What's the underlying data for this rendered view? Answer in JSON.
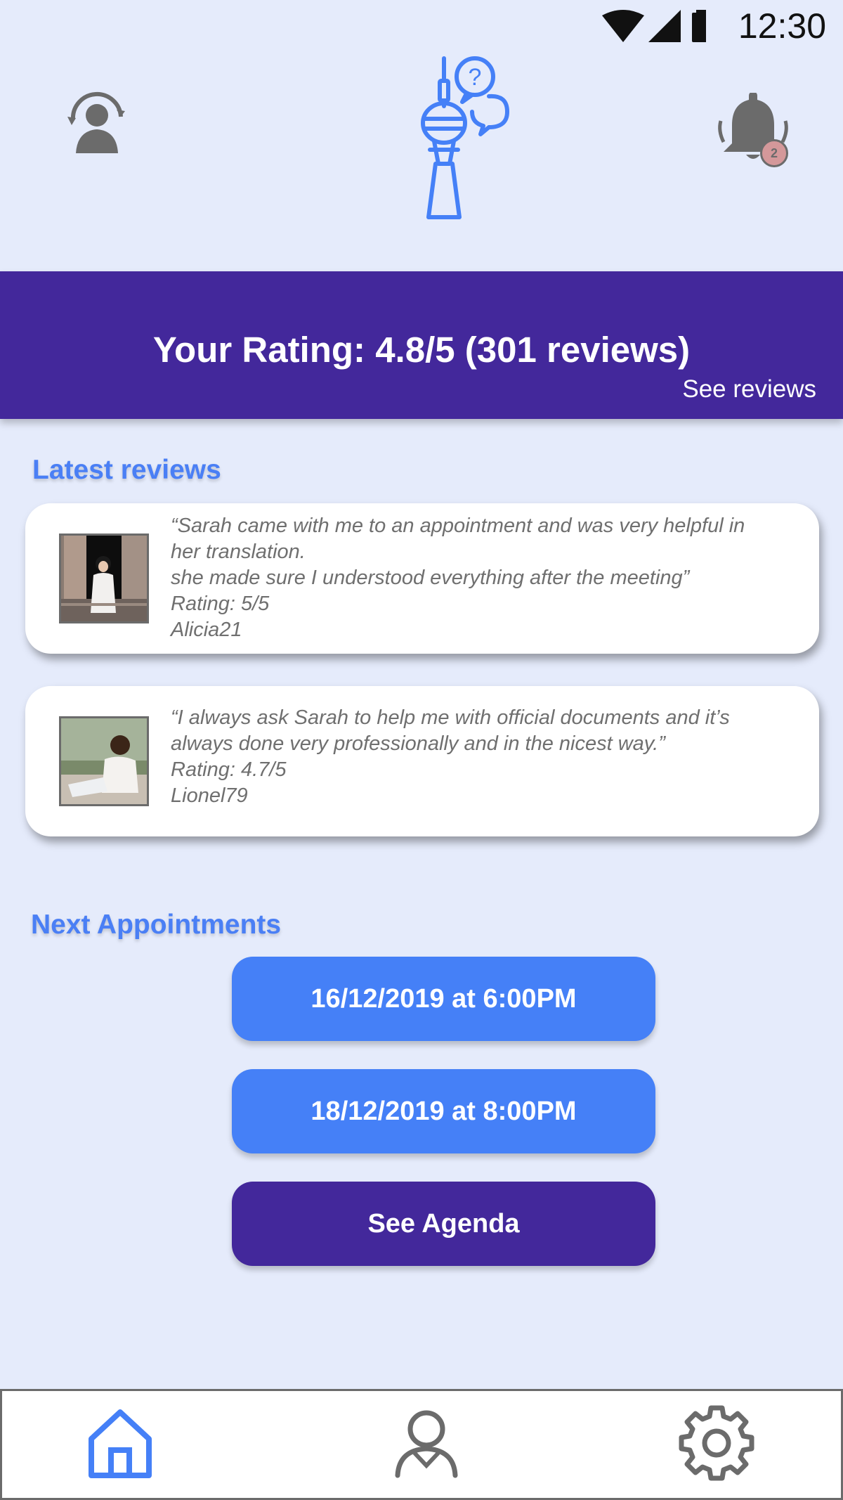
{
  "status_bar": {
    "time": "12:30"
  },
  "header": {
    "profile_icon": "user-switch-icon",
    "logo_icon": "tower-question-logo",
    "notification_icon": "bell-icon",
    "notification_count": "2"
  },
  "rating": {
    "title": "Your Rating: 4.8/5 (301 reviews)",
    "see_reviews": "See reviews"
  },
  "latest_reviews": {
    "heading": "Latest reviews",
    "items": [
      {
        "lines": [
          "“Sarah came with me to an appointment and was very helpful in",
          "her translation.",
          "she made sure I understood everything after the meeting”"
        ],
        "rating": "Rating: 5/5",
        "author": "Alicia21"
      },
      {
        "lines": [
          "“I always ask Sarah to help me with official documents and it’s",
          "always done very professionally and in the nicest way.”"
        ],
        "rating": "Rating: 4.7/5",
        "author": "Lionel79"
      }
    ]
  },
  "appointments": {
    "heading": "Next Appointments",
    "items": [
      "16/12/2019 at 6:00PM",
      "18/12/2019 at 8:00PM"
    ],
    "agenda_button": "See Agenda"
  },
  "bottom_nav": {
    "items": [
      {
        "icon": "home-icon",
        "active": true
      },
      {
        "icon": "profile-icon",
        "active": false
      },
      {
        "icon": "settings-gear-icon",
        "active": false
      }
    ]
  },
  "colors": {
    "background": "#e5ebfb",
    "primary_purple": "#43289b",
    "accent_blue": "#4580f7",
    "icon_gray": "#6b6b6b",
    "badge": "#d4989a"
  }
}
